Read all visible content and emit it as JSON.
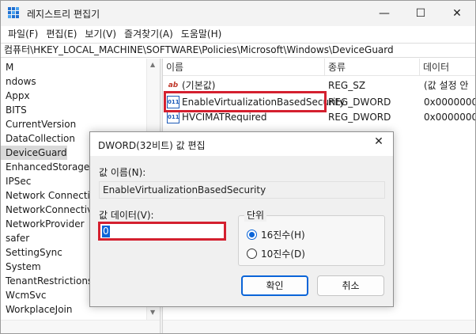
{
  "window": {
    "title": "레지스트리 편집기",
    "controls": {
      "minimize": "—",
      "maximize": "☐",
      "close": "✕"
    }
  },
  "menu": [
    "파일(F)",
    "편집(E)",
    "보기(V)",
    "즐겨찾기(A)",
    "도움말(H)"
  ],
  "address": "컴퓨터\\HKEY_LOCAL_MACHINE\\SOFTWARE\\Policies\\Microsoft\\Windows\\DeviceGuard",
  "tree": {
    "items": [
      "M",
      "ndows",
      "Appx",
      "BITS",
      "CurrentVersion",
      "DataCollection",
      "DeviceGuard",
      "EnhancedStorageDe",
      "IPSec",
      "Network Connection",
      "NetworkConnectivit",
      "NetworkProvider",
      "safer",
      "SettingSync",
      "System",
      "TenantRestrictions",
      "WcmSvc",
      "WorkplaceJoin"
    ],
    "selected_index": 6
  },
  "list": {
    "columns": [
      "이름",
      "종류",
      "데이터"
    ],
    "rows": [
      {
        "icon": "ab",
        "name": "(기본값)",
        "type": "REG_SZ",
        "data": "(값 설정 안"
      },
      {
        "icon": "011",
        "name": "EnableVirtualizationBasedSecurity",
        "type": "REG_DWORD",
        "data": "0x0000000"
      },
      {
        "icon": "011",
        "name": "HVCIMATRequired",
        "type": "REG_DWORD",
        "data": "0x0000000"
      }
    ]
  },
  "dialog": {
    "title": "DWORD(32비트) 값 편집",
    "close": "✕",
    "name_label": "값 이름(N):",
    "name_value": "EnableVirtualizationBasedSecurity",
    "data_label": "값 데이터(V):",
    "data_value": "0",
    "base_label": "단위",
    "hex_label": "16진수(H)",
    "dec_label": "10진수(D)",
    "ok": "확인",
    "cancel": "취소"
  },
  "colors": {
    "highlight_box": "#d4202f",
    "accent": "#0a64d8"
  }
}
